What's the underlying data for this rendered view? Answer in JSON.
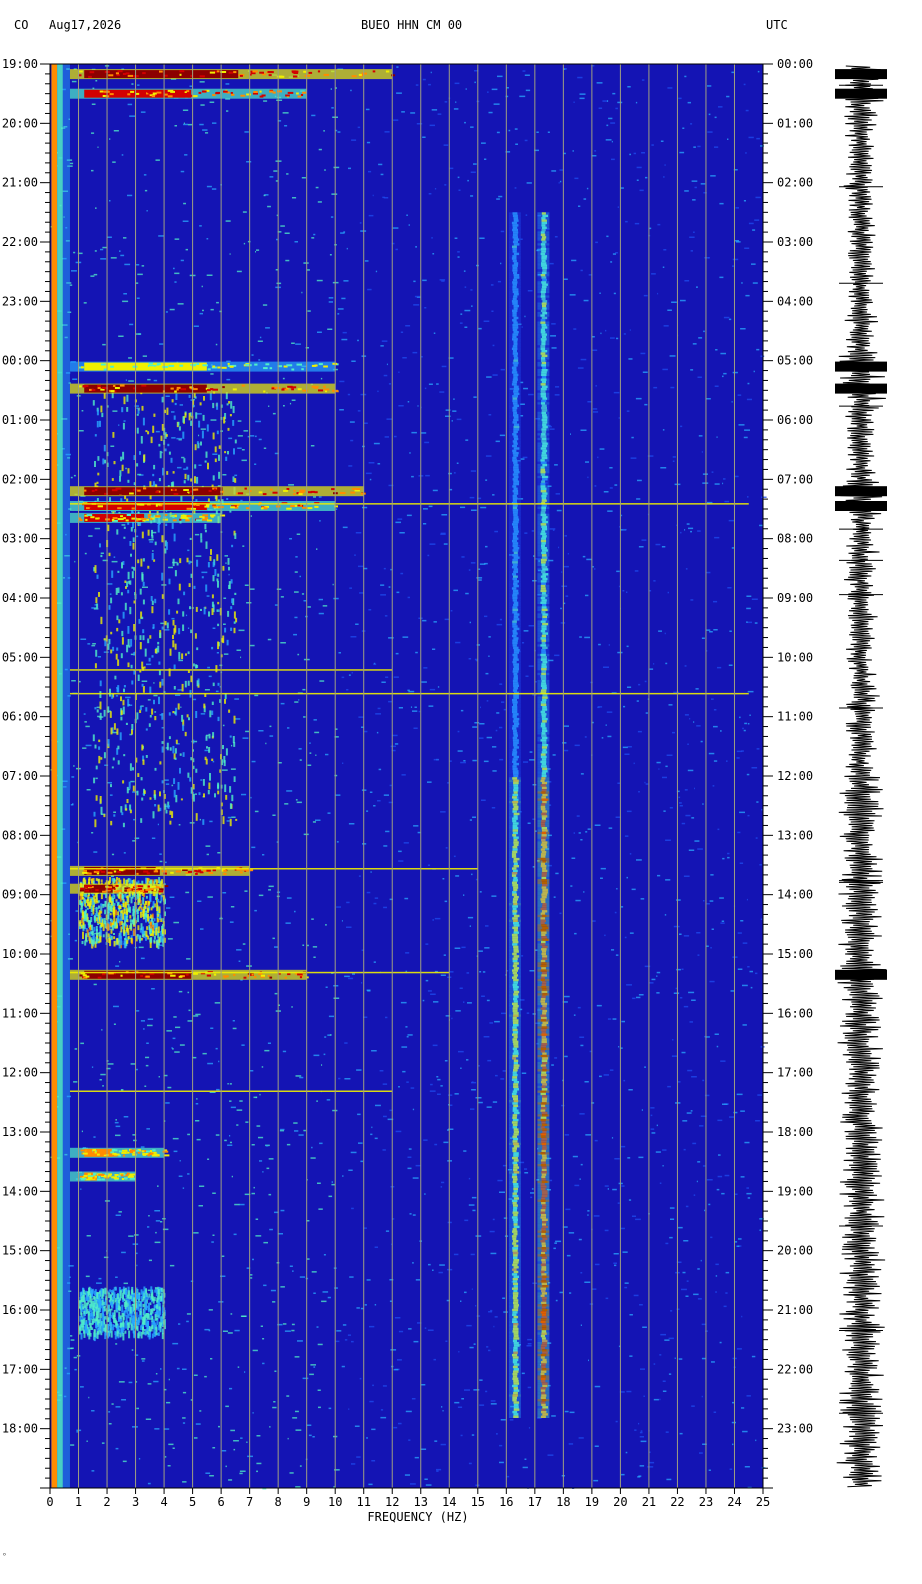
{
  "header": {
    "network": "CO",
    "date": "Aug17,2026",
    "station": "BUEO HHN CM 00",
    "tz": "UTC"
  },
  "footer_mark": "ᵒ",
  "chart_data": {
    "type": "heatmap",
    "title": "BUEO HHN CM 00",
    "xlabel": "FREQUENCY (HZ)",
    "xlim": [
      0,
      25
    ],
    "x_ticks": [
      "0",
      "1",
      "2",
      "3",
      "4",
      "5",
      "6",
      "7",
      "8",
      "9",
      "10",
      "11",
      "12",
      "13",
      "14",
      "15",
      "16",
      "17",
      "18",
      "19",
      "20",
      "21",
      "22",
      "23",
      "24",
      "25"
    ],
    "left_axis_labels": [
      "19:00",
      "20:00",
      "21:00",
      "22:00",
      "23:00",
      "00:00",
      "01:00",
      "02:00",
      "03:00",
      "04:00",
      "05:00",
      "06:00",
      "07:00",
      "08:00",
      "09:00",
      "10:00",
      "11:00",
      "12:00",
      "13:00",
      "14:00",
      "15:00",
      "16:00",
      "17:00",
      "18:00"
    ],
    "right_axis_labels": [
      "00:00",
      "01:00",
      "02:00",
      "03:00",
      "04:00",
      "05:00",
      "06:00",
      "07:00",
      "08:00",
      "09:00",
      "10:00",
      "11:00",
      "12:00",
      "13:00",
      "14:00",
      "15:00",
      "16:00",
      "17:00",
      "18:00",
      "19:00",
      "20:00",
      "21:00",
      "22:00",
      "23:00"
    ],
    "ylim_hours": [
      0,
      24
    ],
    "grid": true,
    "colormap": [
      "#0000c8",
      "#1e4cf0",
      "#28a8ff",
      "#50f0c8",
      "#f0f000",
      "#ff8c00",
      "#d20000",
      "#8c0000"
    ],
    "background_color": "#1414b4",
    "grid_color": "#a0a080",
    "broadband_events": [
      {
        "t": 0.17,
        "f_max": 12,
        "intensity": 0.95
      },
      {
        "t": 0.5,
        "f_max": 9,
        "intensity": 0.9
      },
      {
        "t": 5.1,
        "f_max": 10,
        "intensity": 0.6
      },
      {
        "t": 5.47,
        "f_max": 10,
        "intensity": 0.95
      },
      {
        "t": 7.2,
        "f_max": 11,
        "intensity": 1.0
      },
      {
        "t": 7.45,
        "f_max": 10,
        "intensity": 0.9
      },
      {
        "t": 7.65,
        "f_max": 6,
        "intensity": 0.8
      },
      {
        "t": 13.6,
        "f_max": 7,
        "intensity": 0.95
      },
      {
        "t": 13.9,
        "f_max": 4,
        "intensity": 1.0
      },
      {
        "t": 15.35,
        "f_max": 9,
        "intensity": 1.0
      },
      {
        "t": 18.35,
        "f_max": 4,
        "intensity": 0.7
      },
      {
        "t": 18.75,
        "f_max": 3,
        "intensity": 0.7
      }
    ],
    "thin_lines": [
      {
        "t": 7.4,
        "f_max": 24.5
      },
      {
        "t": 10.2,
        "f_max": 12
      },
      {
        "t": 10.6,
        "f_max": 24.5
      },
      {
        "t": 13.55,
        "f_max": 15
      },
      {
        "t": 15.3,
        "f_max": 14
      },
      {
        "t": 17.3,
        "f_max": 12
      }
    ],
    "tonal_lines": [
      {
        "f": 16.3,
        "t_start": 2.5,
        "t_end": 22.8,
        "peak_start": 12.0,
        "intensity": 0.6
      },
      {
        "f": 17.3,
        "t_start": 2.5,
        "t_end": 22.8,
        "peak_start": 12.0,
        "intensity": 0.9
      }
    ],
    "low_freq_patches": [
      {
        "f_min": 1.5,
        "f_max": 6.5,
        "t_start": 5.5,
        "t_end": 12.8,
        "intensity": 0.55
      },
      {
        "f_min": 1.0,
        "f_max": 4.0,
        "t_start": 13.7,
        "t_end": 14.8,
        "intensity": 0.6
      },
      {
        "f_min": 1.0,
        "f_max": 4.0,
        "t_start": 20.6,
        "t_end": 21.4,
        "intensity": 0.45
      }
    ],
    "seismogram_bursts": [
      0.17,
      0.5,
      5.1,
      5.47,
      7.2,
      7.45,
      15.35
    ]
  }
}
